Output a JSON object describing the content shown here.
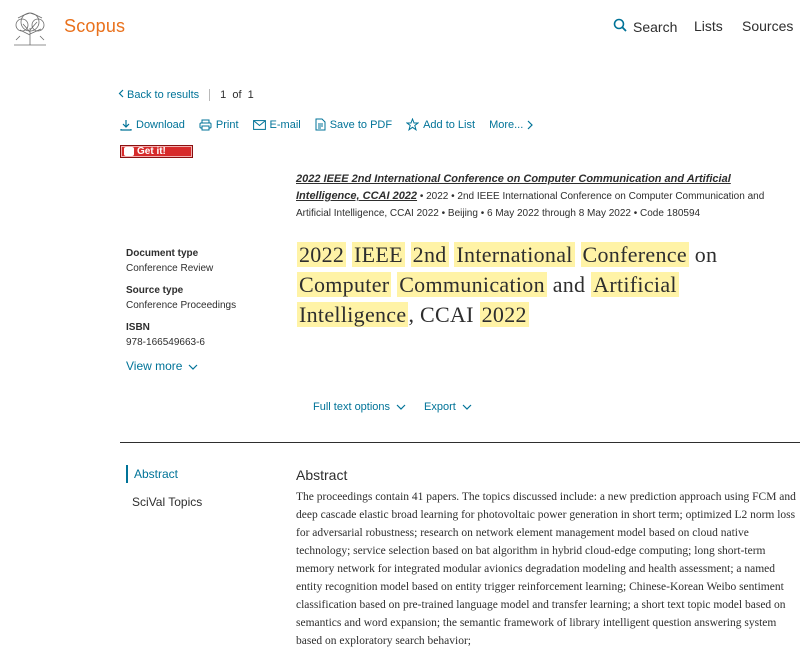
{
  "header": {
    "brand": "Scopus",
    "nav": {
      "search": "Search",
      "lists": "Lists",
      "sources": "Sources"
    }
  },
  "back_row": {
    "back_label": "Back to results",
    "pager": "1  of  1"
  },
  "toolbar": {
    "download": "Download",
    "print": "Print",
    "email": "E-mail",
    "save_pdf": "Save to PDF",
    "add_list": "Add to List",
    "more": "More..."
  },
  "getit_label": "Get it!",
  "source": {
    "conference": "2022 IEEE 2nd International Conference on Computer Communication and Artificial Intelligence, CCAI 2022",
    "details": " • 2022 • 2nd IEEE International Conference on Computer Communication and Artificial Intelligence, CCAI 2022 • Beijing • 6 May 2022 through 8 May 2022 • Code 180594"
  },
  "meta": {
    "doc_type_label": "Document type",
    "doc_type_value": "Conference Review",
    "source_type_label": "Source type",
    "source_type_value": "Conference Proceedings",
    "isbn_label": "ISBN",
    "isbn_value": "978-166549663-6",
    "view_more": "View more"
  },
  "title_words": [
    {
      "w": "2022",
      "hl": true
    },
    {
      "w": "IEEE",
      "hl": true
    },
    {
      "w": "2nd",
      "hl": true
    },
    {
      "w": "International",
      "hl": true
    },
    {
      "w": "Conference",
      "hl": true
    },
    {
      "w": "on",
      "hl": false
    },
    {
      "w": "Computer",
      "hl": true
    },
    {
      "w": "Communication",
      "hl": true
    },
    {
      "w": "and",
      "hl": false
    },
    {
      "w": "Artificial",
      "hl": true
    },
    {
      "w": "Intelligence",
      "hl": true
    },
    {
      "w": ", CCAI",
      "hl": false
    },
    {
      "w": "2022",
      "hl": true
    }
  ],
  "options": {
    "full_text": "Full text options",
    "export": "Export"
  },
  "sidenav": {
    "abstract": "Abstract",
    "scival": "SciVal Topics"
  },
  "abstract": {
    "heading": "Abstract",
    "text": "The proceedings contain 41 papers. The topics discussed include: a new prediction approach using FCM and deep cascade elastic broad learning for photovoltaic power generation in short term; optimized L2 norm loss for adversarial robustness; research on network element management model based on cloud native technology; service selection based on bat algorithm in hybrid cloud-edge computing; long short-term memory network for integrated modular avionics degradation modeling and health assessment; a named entity recognition model based on entity trigger reinforcement learning; Chinese-Korean Weibo sentiment classification based on pre-trained language model and transfer learning; a short text topic model based on semantics and word expansion; the semantic framework of library intelligent question answering system based on exploratory search behavior;"
  },
  "colors": {
    "brand": "#e9711c",
    "link": "#007398",
    "highlight": "#fff3a6",
    "getit": "#d72b2b"
  }
}
